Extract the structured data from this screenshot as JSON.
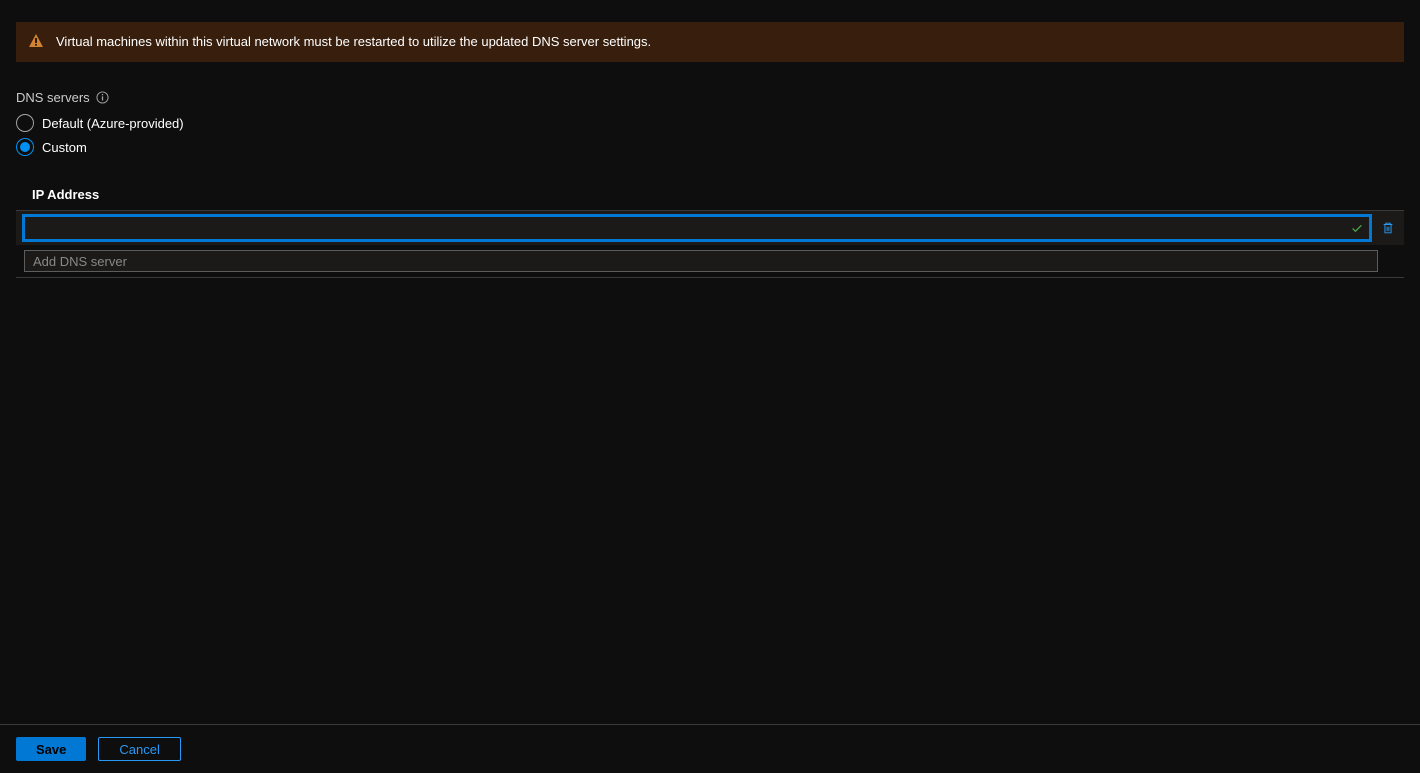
{
  "banner": {
    "message": "Virtual machines within this virtual network must be restarted to utilize the updated DNS server settings."
  },
  "dns": {
    "section_label": "DNS servers",
    "options": {
      "default_label": "Default (Azure-provided)",
      "custom_label": "Custom"
    },
    "selected": "custom",
    "ip_header": "IP Address",
    "entries": [
      {
        "value": ""
      }
    ],
    "add_placeholder": "Add DNS server"
  },
  "footer": {
    "save_label": "Save",
    "cancel_label": "Cancel"
  }
}
